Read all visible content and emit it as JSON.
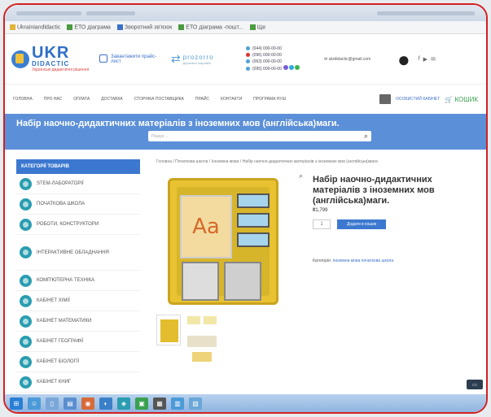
{
  "browser": {
    "bookmarks": [
      "Ukrainiandidactic",
      "ЕТО діаграма",
      "Зворотний зв'язок",
      "ЕТО діаграма -пошт...",
      "Ще"
    ]
  },
  "header": {
    "logo_big": "UKR",
    "logo_small": "DIDACTIC",
    "logo_tag": "Українські дидактичні рішення",
    "link_label": "Завантажити прайс-лист",
    "prozorro": "prozorro",
    "prozorro_sub": "державні закупівлі",
    "phones": [
      "(044) 000-00-00",
      "(096) 000-00-00",
      "(063) 000-00-00",
      "(095) 000-00-00"
    ],
    "email": "ukrdidactic@gmail.com"
  },
  "nav": {
    "items": [
      "Головна",
      "Про нас",
      "Оплата",
      "Доставка",
      "Сторінка поставщика",
      "Прайс",
      "Контакти",
      "Програма НУШ"
    ],
    "cabinet": "Особистий кабінет",
    "cart": "Кошик"
  },
  "banner": {
    "title": "Набір наочно-дидактичних матеріалів з іноземних мов (англійська)маги.",
    "search_placeholder": "Пошук ..."
  },
  "sidebar": {
    "heading": "Категорії товарів",
    "items": [
      "STEM-лабораторії",
      "Початкова школа",
      "Роботи, конструктори",
      "Інтерактивне обладнання",
      "Комп'ютерна техніка",
      "Кабінет хімії",
      "Кабінет математики",
      "Кабінет географії",
      "Кабінет біології",
      "Кабінет книг"
    ]
  },
  "product": {
    "breadcrumb": "Головна / Початкова школа / Іноземна мова / Набір наочно-дидактичних матеріалів з іноземних мов (англійська)маги.",
    "card_text": "Aa",
    "title": "Набір наочно-дидактичних матеріалів з іноземних мов (англійська)маги.",
    "price": "₴1,799",
    "qty": "1",
    "buy_label": "Додати в кошик",
    "category_label": "Категорія:",
    "category_value": "Іноземна мова початкова школа"
  }
}
